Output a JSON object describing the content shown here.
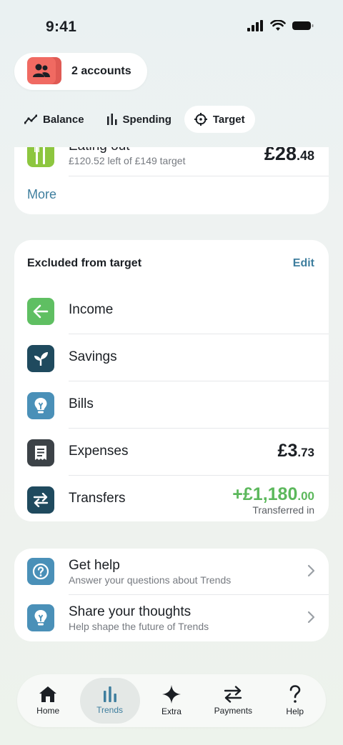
{
  "status_bar": {
    "time": "9:41"
  },
  "accounts": {
    "label": "2 accounts",
    "icon": "people-icon"
  },
  "tabs": [
    {
      "label": "Balance",
      "icon": "line-chart-icon",
      "active": false
    },
    {
      "label": "Spending",
      "icon": "bar-chart-icon",
      "active": false
    },
    {
      "label": "Target",
      "icon": "target-icon",
      "active": true
    }
  ],
  "eating_out": {
    "title": "Eating out",
    "subtitle": "£120.52 left of £149 target",
    "amount_main": "£28",
    "amount_pence": ".48",
    "color": "#8dc63f",
    "icon": "cutlery-icon"
  },
  "more_label": "More",
  "excluded": {
    "header": "Excluded from target",
    "edit_label": "Edit",
    "rows": [
      {
        "label": "Income",
        "icon": "arrow-left-icon",
        "color": "#5fbf62"
      },
      {
        "label": "Savings",
        "icon": "sprout-icon",
        "color": "#1f4a5e"
      },
      {
        "label": "Bills",
        "icon": "lightbulb-icon",
        "color": "#4a90b8"
      },
      {
        "label": "Expenses",
        "icon": "receipt-icon",
        "color": "#3c4247",
        "amount_main": "£3",
        "amount_pence": ".73"
      },
      {
        "label": "Transfers",
        "icon": "transfer-icon",
        "color": "#1f4a5e",
        "amount_main": "+£1,180",
        "amount_pence": ".00",
        "note": "Transferred in"
      }
    ]
  },
  "help": {
    "rows": [
      {
        "title": "Get help",
        "subtitle": "Answer your questions about Trends",
        "icon": "question-icon"
      },
      {
        "title": "Share your thoughts",
        "subtitle": "Help shape the future of Trends",
        "icon": "lightbulb-icon"
      }
    ]
  },
  "nav": [
    {
      "label": "Home",
      "icon": "home-icon",
      "active": false
    },
    {
      "label": "Trends",
      "icon": "bar-chart-icon",
      "active": true
    },
    {
      "label": "Extra",
      "icon": "sparkle-icon",
      "active": false
    },
    {
      "label": "Payments",
      "icon": "transfer-icon",
      "active": false
    },
    {
      "label": "Help",
      "icon": "question-mark-icon",
      "active": false
    }
  ],
  "colors": {
    "accent": "#3e7e9e",
    "positive": "#5cb85c",
    "accounts_red": "#f06a62"
  }
}
